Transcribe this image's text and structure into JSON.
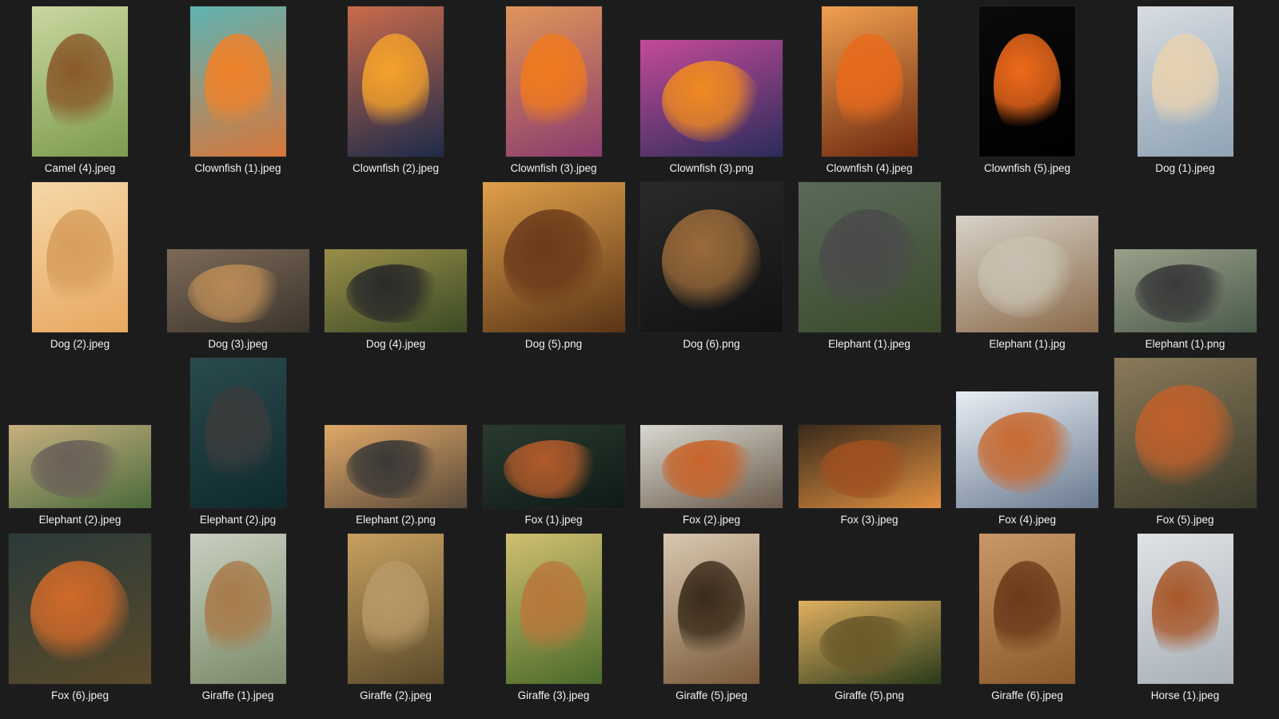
{
  "window": {
    "background": "#1c1c1c",
    "caption_color": "#f2f2f2"
  },
  "files": [
    {
      "name": "Camel (4).jpeg",
      "shape": "portrait",
      "bg": [
        "#7d9b4e",
        "#c9d7a0"
      ],
      "subject": "#8a5a2b"
    },
    {
      "name": "Clownfish (1).jpeg",
      "shape": "portrait",
      "bg": [
        "#d7763a",
        "#5fb3b3"
      ],
      "subject": "#f0822a"
    },
    {
      "name": "Clownfish (2).jpeg",
      "shape": "portrait",
      "bg": [
        "#1e2b4a",
        "#c96b4b"
      ],
      "subject": "#f4a12b"
    },
    {
      "name": "Clownfish (3).jpeg",
      "shape": "portrait",
      "bg": [
        "#8a3c6e",
        "#e0955a"
      ],
      "subject": "#f07a1e"
    },
    {
      "name": "Clownfish (3).png",
      "shape": "wide",
      "bg": [
        "#2a2c5a",
        "#c44a9a"
      ],
      "subject": "#f08a20"
    },
    {
      "name": "Clownfish (4).jpeg",
      "shape": "portrait",
      "bg": [
        "#6e2a10",
        "#f0a050"
      ],
      "subject": "#e86a1c"
    },
    {
      "name": "Clownfish (5).jpeg",
      "shape": "portrait",
      "bg": [
        "#000000",
        "#0a0a0a"
      ],
      "subject": "#f06a1a"
    },
    {
      "name": "Dog (1).jpeg",
      "shape": "portrait",
      "bg": [
        "#8fa3b5",
        "#d8dde2"
      ],
      "subject": "#e8d2b0"
    },
    {
      "name": "Dog (2).jpeg",
      "shape": "portrait",
      "bg": [
        "#e8a860",
        "#f6d7a8"
      ],
      "subject": "#d79e5c"
    },
    {
      "name": "Dog (3).jpeg",
      "shape": "landscape",
      "bg": [
        "#3c342c",
        "#7c6a58"
      ],
      "subject": "#b88a56"
    },
    {
      "name": "Dog (4).jpeg",
      "shape": "landscape",
      "bg": [
        "#3a4a24",
        "#9a8e4a"
      ],
      "subject": "#2a2a2a"
    },
    {
      "name": "Dog (5).png",
      "shape": "square",
      "bg": [
        "#5a3416",
        "#e0a04a"
      ],
      "subject": "#6a3a1a"
    },
    {
      "name": "Dog (6).png",
      "shape": "square",
      "bg": [
        "#111111",
        "#2a2a2a"
      ],
      "subject": "#9a6a3a"
    },
    {
      "name": "Elephant (1).jpeg",
      "shape": "square",
      "bg": [
        "#3a4a2a",
        "#5a6a5a"
      ],
      "subject": "#4a4a4a"
    },
    {
      "name": "Elephant (1).jpg",
      "shape": "wide",
      "bg": [
        "#8a6a4a",
        "#d8d2c8"
      ],
      "subject": "#c8c0b0"
    },
    {
      "name": "Elephant (1).png",
      "shape": "landscape",
      "bg": [
        "#4a5a4a",
        "#9aa08a"
      ],
      "subject": "#3a3a3a"
    },
    {
      "name": "Elephant (2).jpeg",
      "shape": "landscape",
      "bg": [
        "#4a6a3a",
        "#c8b080"
      ],
      "subject": "#6a6058"
    },
    {
      "name": "Elephant (2).jpg",
      "shape": "portrait",
      "bg": [
        "#0f2a2e",
        "#2a4a4e"
      ],
      "subject": "#3a3c3c"
    },
    {
      "name": "Elephant (2).png",
      "shape": "landscape",
      "bg": [
        "#5a4a3a",
        "#e0a868"
      ],
      "subject": "#3a3836"
    },
    {
      "name": "Fox (1).jpeg",
      "shape": "landscape",
      "bg": [
        "#0e1a16",
        "#2a3a30"
      ],
      "subject": "#b05a2a"
    },
    {
      "name": "Fox (2).jpeg",
      "shape": "landscape",
      "bg": [
        "#6a5a4a",
        "#d8d8d0"
      ],
      "subject": "#c8642a"
    },
    {
      "name": "Fox (3).jpeg",
      "shape": "landscape",
      "bg": [
        "#e09040",
        "#3a2a1a"
      ],
      "subject": "#a05020"
    },
    {
      "name": "Fox (4).jpeg",
      "shape": "wide",
      "bg": [
        "#6a7a90",
        "#e8eef4"
      ],
      "subject": "#c86a30"
    },
    {
      "name": "Fox (5).jpeg",
      "shape": "square",
      "bg": [
        "#3a3a2a",
        "#8a7a5a"
      ],
      "subject": "#c0602a"
    },
    {
      "name": "Fox (6).jpeg",
      "shape": "square",
      "bg": [
        "#5a4a2a",
        "#2a3a3a"
      ],
      "subject": "#d06a2a"
    },
    {
      "name": "Giraffe (1).jpeg",
      "shape": "portrait",
      "bg": [
        "#7a8a6a",
        "#c8d0c0"
      ],
      "subject": "#a87a4a"
    },
    {
      "name": "Giraffe (2).jpeg",
      "shape": "portrait",
      "bg": [
        "#5a4a2a",
        "#c8a060"
      ],
      "subject": "#b89868"
    },
    {
      "name": "Giraffe (3).jpeg",
      "shape": "portrait",
      "bg": [
        "#4a6a2a",
        "#d0c070"
      ],
      "subject": "#b8783a"
    },
    {
      "name": "Giraffe (5).jpeg",
      "shape": "portrait",
      "bg": [
        "#7a5a3a",
        "#d8c8b0"
      ],
      "subject": "#3a2a1a"
    },
    {
      "name": "Giraffe (5).png",
      "shape": "landscape",
      "bg": [
        "#2a3a1a",
        "#e0b060"
      ],
      "subject": "#6a5a2a"
    },
    {
      "name": "Giraffe (6).jpeg",
      "shape": "portrait",
      "bg": [
        "#8a5a2a",
        "#c89868"
      ],
      "subject": "#6a3a1a"
    },
    {
      "name": "Horse (1).jpeg",
      "shape": "portrait",
      "bg": [
        "#a8b0b8",
        "#dfe3e6"
      ],
      "subject": "#a8582a"
    }
  ]
}
